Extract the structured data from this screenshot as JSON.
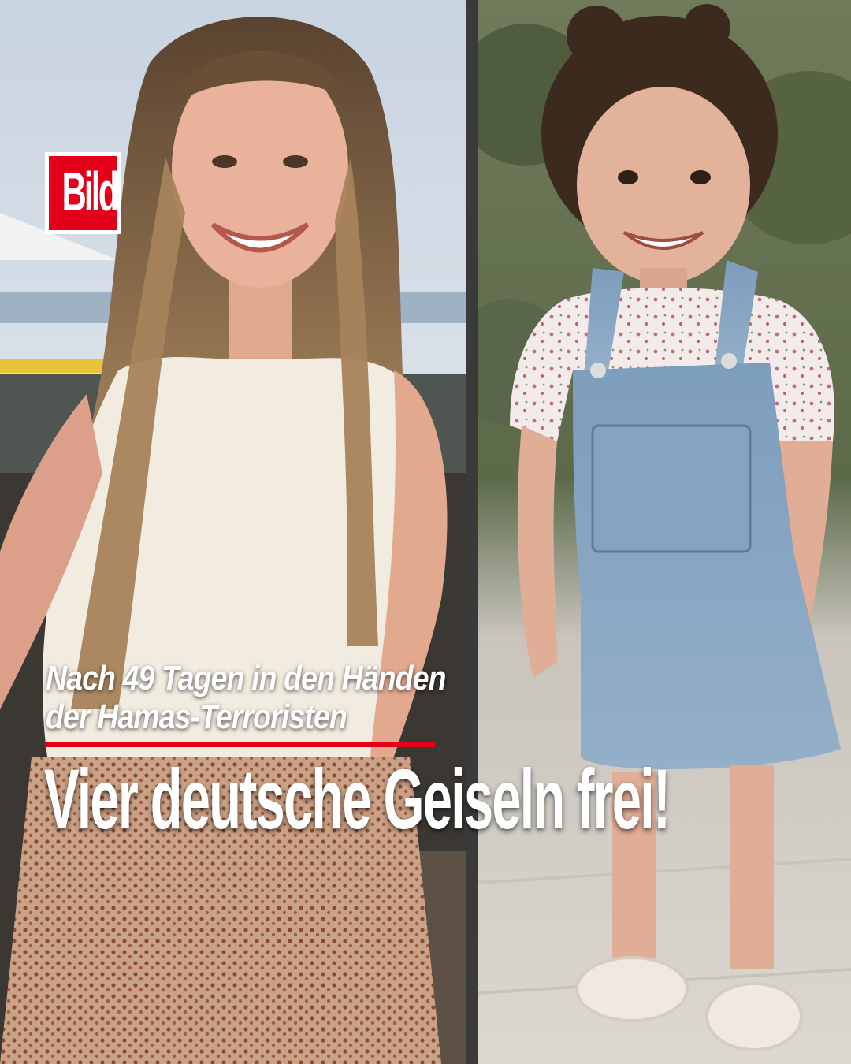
{
  "brand": {
    "logo_text": "Bild",
    "accent_color": "#e3001b"
  },
  "photos": [
    {
      "name": "photo-woman",
      "subject": "smiling woman with long hair, white top, patterned skirt"
    },
    {
      "name": "photo-girl",
      "subject": "smiling little girl in denim pinafore dress and sandals"
    }
  ],
  "kicker": {
    "line1": "Nach 49 Tagen in den Händen",
    "line2": "der Hamas-Terroristen"
  },
  "headline": "Vier deutsche Geiseln frei!"
}
